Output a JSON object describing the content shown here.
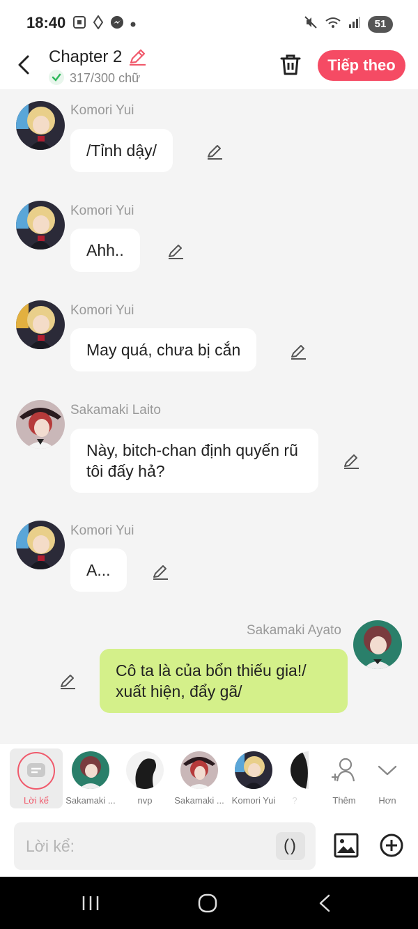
{
  "status_bar": {
    "time": "18:40",
    "battery": "51"
  },
  "header": {
    "title": "Chapter 2",
    "word_count": "317/300 chữ",
    "next_label": "Tiếp theo"
  },
  "messages": [
    {
      "sender": "Komori Yui",
      "text": "/Tỉnh dậy/"
    },
    {
      "sender": "Komori Yui",
      "text": "Ahh.."
    },
    {
      "sender": "Komori Yui",
      "text": "May quá, chưa bị cắn"
    },
    {
      "sender": "Sakamaki Laito",
      "text": "Này, bitch-chan định quyến rũ tôi đấy hả?"
    },
    {
      "sender": "Komori Yui",
      "text": "A..."
    },
    {
      "sender": "Sakamaki Ayato",
      "text": "Cô ta là của bổn thiếu gia!/ xuất hiện, đẩy gã/"
    }
  ],
  "character_bar": {
    "narrator_label": "Lời kể",
    "characters": [
      {
        "label": "Sakamaki ..."
      },
      {
        "label": "nvp"
      },
      {
        "label": "Sakamaki ..."
      },
      {
        "label": "Komori Yui"
      },
      {
        "label": "?"
      }
    ],
    "add_label": "Thêm",
    "more_label": "Hơn"
  },
  "input": {
    "placeholder": "Lời kể:",
    "paren_label": "()"
  }
}
